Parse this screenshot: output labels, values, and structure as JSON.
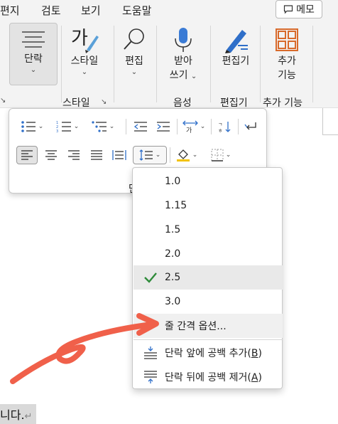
{
  "menubar": {
    "tabs": [
      "편지",
      "검토",
      "보기",
      "도움말"
    ],
    "memo_label": "메모"
  },
  "ribbon": {
    "paragraph_label": "단락",
    "style_label": "스타일",
    "edit_label": "편집",
    "dictate_line1": "받아",
    "dictate_line2": "쓰기",
    "editor_label": "편집기",
    "addin_line1": "추가",
    "addin_line2": "기능",
    "groups": {
      "style": "스타일",
      "voice": "음성",
      "editor": "편집기",
      "addins": "추가 기능"
    }
  },
  "paragraph_panel": {
    "label": "단락"
  },
  "line_spacing_menu": {
    "options": [
      "1.0",
      "1.15",
      "1.5",
      "2.0",
      "2.5",
      "3.0"
    ],
    "selected": "2.5",
    "line_spacing_options": "줄 간격 옵션...",
    "add_space_before": "단락 앞에 공백 추가",
    "add_space_before_key": "B",
    "remove_space_after": "단락 뒤에 공백 제거",
    "remove_space_after_key": "A"
  },
  "document": {
    "text": "니다."
  },
  "colors": {
    "accent_check": "#2e8b3a",
    "arrow": "#f0604a",
    "mic": "#3a7bd5",
    "addin_icon": "#d86a2b",
    "highlighter": "#f2c200"
  },
  "icons": {
    "memo": "comment-icon",
    "style": "style-brush-icon",
    "edit": "magnifier-icon",
    "dictate": "microphone-icon",
    "editor": "pen-icon",
    "addins": "grid-apps-icon",
    "check": "check-icon"
  }
}
